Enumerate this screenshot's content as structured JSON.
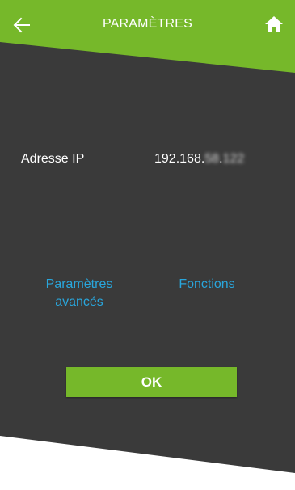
{
  "header": {
    "title": "PARAMÈTRES",
    "back_icon": "arrow-left-icon",
    "home_icon": "home-icon"
  },
  "network": {
    "ip_label": "Adresse IP",
    "ip_prefix": "192.168.",
    "ip_masked_1": "58",
    "ip_separator": ".",
    "ip_masked_2": "122"
  },
  "links": {
    "advanced": "Paramètres avancés",
    "functions": "Fonctions"
  },
  "actions": {
    "ok_label": "OK"
  },
  "colors": {
    "accent_green": "#76b82a",
    "panel_dark": "#3a3a3a",
    "link_blue": "#29a6dc"
  }
}
